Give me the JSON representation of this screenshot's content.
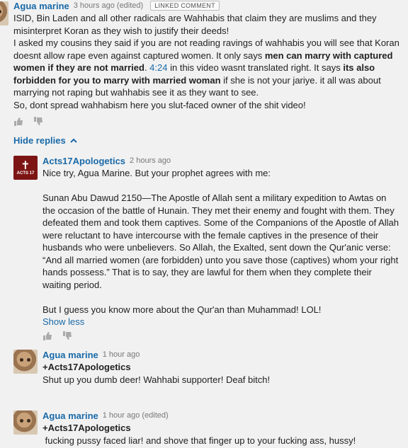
{
  "thread": {
    "root": {
      "author": "Agua marine",
      "time": "3 hours ago (edited)",
      "badge": "LINKED COMMENT",
      "p1": "ISID, Bin Laden and all other radicals are Wahhabis that claim they are muslims and they misinterpret Koran as they wish to justify their deeds!",
      "p2a": "I asked my cousins they said if you are not reading ravings of wahhabis you will see that Koran doesnt allow rape even against captured women. It only says ",
      "p2b": "men can marry with captured women if they are not married",
      "p2c": ". ",
      "p2link": "4:24",
      "p2d": " in this video wasnt translated right. It says ",
      "p2e": "its also forbidden for you to marry with married woman",
      "p2f": " if she is not your jariye. it all was about marrying not raping but wahhabis see it as they want to see.",
      "p3": "So, dont spread wahhabism here you slut-faced owner of the shit video!"
    },
    "hide_replies": "Hide replies",
    "replies": [
      {
        "author": "Acts17Apologetics",
        "time": "2 hours ago",
        "avatar_text": "ACTS 17",
        "l1": "Nice try, Agua Marine. But your prophet agrees with me:",
        "l2": "Sunan Abu Dawud 2150—The Apostle of Allah sent a military expedition to Awtas on the occasion of the battle of Hunain. They met their enemy and fought with them. They defeated them and took them captives. Some of the Companions of the Apostle of Allah were reluctant to have intercourse with the female captives in the presence of their husbands who were unbelievers. So Allah, the Exalted, sent down the Qur'anic verse: “And all married women (are forbidden) unto you save those (captives) whom your right hands possess.” That is to say, they are lawful for them when they complete their waiting period.",
        "l3": "But I guess you know more about the Qur'an than Muhammad! LOL!",
        "show_less": "Show less"
      },
      {
        "author": "Agua marine",
        "time": "1 hour ago",
        "mention": "+Acts17Apologetics",
        "text": "Shut up you dumb deer! Wahhabi supporter! Deaf bitch!"
      },
      {
        "author": "Agua marine",
        "time": "1 hour ago (edited)",
        "mention": "+Acts17Apologetics",
        "text": " fucking pussy faced liar! and shove that finger up to your fucking ass, hussy!"
      }
    ]
  },
  "colors": {
    "link": "#1a6aa8",
    "background": "#f1f1f1",
    "acts_avatar": "#7d1414"
  },
  "icons": [
    "thumb-up-icon",
    "thumb-down-icon",
    "chevron-up-icon",
    "cross-icon"
  ]
}
